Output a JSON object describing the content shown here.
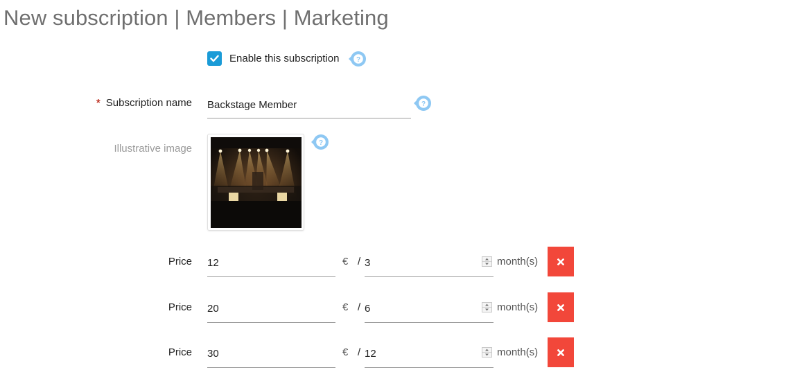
{
  "page": {
    "title": "New subscription | Members | Marketing"
  },
  "form": {
    "enable": {
      "label": "Enable this subscription",
      "checked": true
    },
    "name": {
      "label": "Subscription name",
      "required_marker": "*",
      "value": "Backstage Member"
    },
    "image": {
      "label": "Illustrative image"
    },
    "prices": [
      {
        "label": "Price",
        "amount": "12",
        "currency": "€",
        "separator": "/",
        "period": "3",
        "unit": "month(s)"
      },
      {
        "label": "Price",
        "amount": "20",
        "currency": "€",
        "separator": "/",
        "period": "6",
        "unit": "month(s)"
      },
      {
        "label": "Price",
        "amount": "30",
        "currency": "€",
        "separator": "/",
        "period": "12",
        "unit": "month(s)"
      }
    ]
  },
  "icons": {
    "help": "help-bubble-icon",
    "check": "checkmark-icon",
    "delete": "close-icon"
  },
  "colors": {
    "accent": "#1a9bd7",
    "help": "#8ec8f3",
    "danger": "#f2473a",
    "required": "#c0392b"
  }
}
